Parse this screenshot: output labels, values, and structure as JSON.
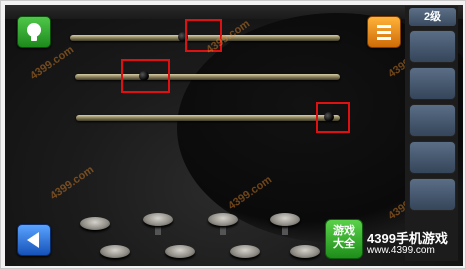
{
  "level": {
    "label": "2级"
  },
  "sliders": [
    {
      "name": "slider-1",
      "value": 0.42
    },
    {
      "name": "slider-2",
      "value": 0.26
    },
    {
      "name": "slider-3",
      "value": 0.96
    }
  ],
  "buttons": {
    "hint": {
      "icon": "lightbulb-icon",
      "color": "#2e9e2a"
    },
    "menu": {
      "icon": "menu-icon",
      "color": "#e98712"
    },
    "back": {
      "icon": "back-arrow-icon",
      "color": "#2f6fd6"
    }
  },
  "watermark": "4399.com",
  "logo": {
    "badge_line1": "游戏",
    "badge_line2": "大全",
    "title": "4399手机游戏",
    "url": "www.4399.com"
  },
  "accent_colors": {
    "highlight_box": "#d11111"
  }
}
